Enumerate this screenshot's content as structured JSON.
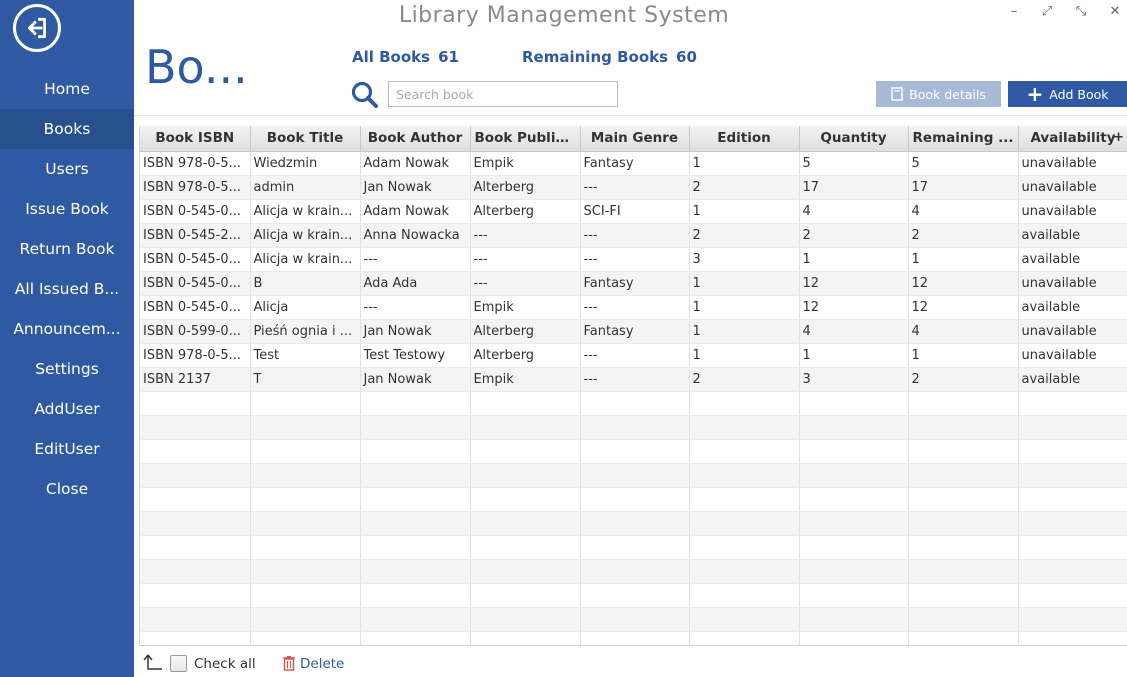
{
  "app": {
    "title": "Library Management System",
    "page_title": "Bo..."
  },
  "window_controls": {
    "minimize": "–",
    "maximize": "⤢",
    "restore": "⤡",
    "close": "✕"
  },
  "sidebar": {
    "items": [
      {
        "label": "Home"
      },
      {
        "label": "Books"
      },
      {
        "label": "Users"
      },
      {
        "label": "Issue Book"
      },
      {
        "label": "Return Book"
      },
      {
        "label": "All Issued B..."
      },
      {
        "label": "Announcem..."
      },
      {
        "label": "Settings"
      },
      {
        "label": "AddUser"
      },
      {
        "label": "EditUser"
      },
      {
        "label": "Close"
      }
    ],
    "active": "Books"
  },
  "stats": {
    "all_books_label": "All Books",
    "all_books_value": "61",
    "remaining_label": "Remaining Books",
    "remaining_value": "60"
  },
  "search": {
    "placeholder": "Search book",
    "value": ""
  },
  "buttons": {
    "details": "Book details",
    "add": "Add Book"
  },
  "table": {
    "columns": [
      "Book ISBN",
      "Book Title",
      "Book Author",
      "Book Publis...",
      "Main Genre",
      "Edition",
      "Quantity",
      "Remaining ...",
      "Availability"
    ],
    "column_menu": "+",
    "rows": [
      [
        "ISBN 978-0-5...",
        "Wiedzmin",
        "Adam Nowak",
        "Empik",
        "Fantasy",
        "1",
        "5",
        "5",
        "unavailable"
      ],
      [
        "ISBN 978-0-5...",
        "admin",
        "Jan Nowak",
        "Alterberg",
        "---",
        "2",
        "17",
        "17",
        "unavailable"
      ],
      [
        "ISBN 0-545-0...",
        "Alicja w krain...",
        "Adam Nowak",
        "Alterberg",
        "SCI-FI",
        "1",
        "4",
        "4",
        "unavailable"
      ],
      [
        "ISBN 0-545-2...",
        "Alicja w krain...",
        "Anna Nowacka",
        "---",
        "---",
        "2",
        "2",
        "2",
        "available"
      ],
      [
        "ISBN 0-545-0...",
        "Alicja w krain...",
        "---",
        "---",
        "---",
        "3",
        "1",
        "1",
        "available"
      ],
      [
        "ISBN 0-545-0...",
        "B",
        "Ada Ada",
        "---",
        "Fantasy",
        "1",
        "12",
        "12",
        "unavailable"
      ],
      [
        "ISBN 0-545-0...",
        "Alicja",
        "---",
        "Empik",
        "---",
        "1",
        "12",
        "12",
        "available"
      ],
      [
        "ISBN 0-599-0...",
        "Pieśń ognia i ...",
        "Jan Nowak",
        "Alterberg",
        "Fantasy",
        "1",
        "4",
        "4",
        "unavailable"
      ],
      [
        "ISBN 978-0-5...",
        "Test",
        "Test Testowy",
        "Alterberg",
        "---",
        "1",
        "1",
        "1",
        "unavailable"
      ],
      [
        "ISBN 2137",
        "T",
        "Jan Nowak",
        "Empik",
        "---",
        "2",
        "3",
        "2",
        "available"
      ]
    ]
  },
  "footer": {
    "check_all": "Check all",
    "delete": "Delete"
  },
  "colors": {
    "sidebar": "#2f5aa3",
    "sidebar_active": "#27508f",
    "accent": "#2f5aa3",
    "delete": "#d9534f",
    "details_disabled": "#a7bbd9"
  }
}
